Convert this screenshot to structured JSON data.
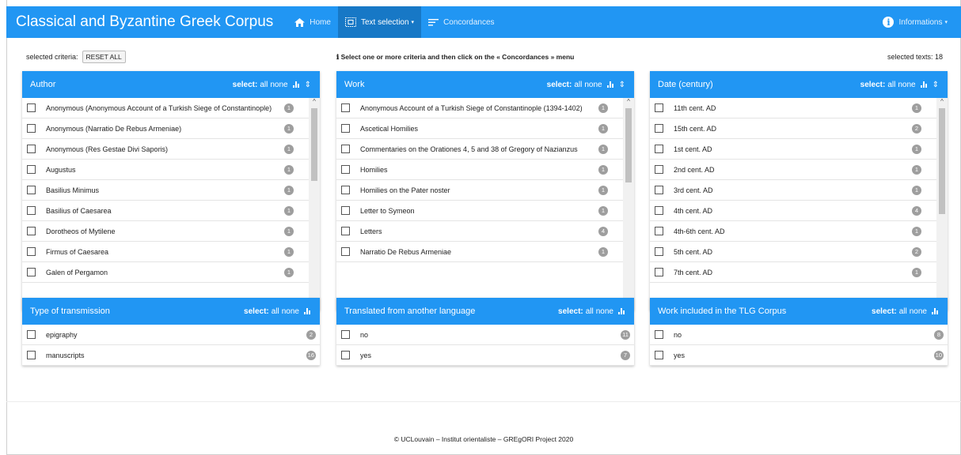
{
  "header": {
    "title": "Classical and Byzantine Greek Corpus",
    "nav": {
      "home": "Home",
      "text_selection": "Text selection",
      "concordances": "Concordances",
      "informations": "Informations"
    }
  },
  "criteria": {
    "label": "selected criteria:",
    "reset": "RESET ALL"
  },
  "hint": "ℹ Select one or more criteria and then click on the « Concordances » menu",
  "selected_texts": "selected texts:  18",
  "select": {
    "label": "select:",
    "all": "all",
    "none": "none"
  },
  "panels": {
    "author": {
      "title": "Author",
      "items": [
        {
          "label": "Anonymous (Anonymous Account of a Turkish Siege of Constantinople)",
          "count": "1"
        },
        {
          "label": "Anonymous (Narratio De Rebus Armeniae)",
          "count": "1"
        },
        {
          "label": "Anonymous (Res Gestae Divi Saporis)",
          "count": "1"
        },
        {
          "label": "Augustus",
          "count": "1"
        },
        {
          "label": "Basilius Minimus",
          "count": "1"
        },
        {
          "label": "Basilius of Caesarea",
          "count": "1"
        },
        {
          "label": "Dorotheos of Mytilene",
          "count": "1"
        },
        {
          "label": "Firmus of Caesarea",
          "count": "1"
        },
        {
          "label": "Galen of Pergamon",
          "count": "1"
        }
      ]
    },
    "work": {
      "title": "Work",
      "items": [
        {
          "label": "Anonymous Account of a Turkish Siege of Constantinople (1394-1402)",
          "count": "1"
        },
        {
          "label": "Ascetical Homilies",
          "count": "1"
        },
        {
          "label": "Commentaries on the Orationes 4, 5 and 38 of Gregory of Nazianzus",
          "count": "1"
        },
        {
          "label": "Homilies",
          "count": "1"
        },
        {
          "label": "Homilies on the Pater noster",
          "count": "1"
        },
        {
          "label": "Letter to Symeon",
          "count": "1"
        },
        {
          "label": "Letters",
          "count": "4"
        },
        {
          "label": "Narratio De Rebus Armeniae",
          "count": "1"
        }
      ]
    },
    "date": {
      "title": "Date (century)",
      "items": [
        {
          "label": "11th cent. AD",
          "count": "1"
        },
        {
          "label": "15th cent. AD",
          "count": "2"
        },
        {
          "label": "1st cent. AD",
          "count": "1"
        },
        {
          "label": "2nd cent. AD",
          "count": "1"
        },
        {
          "label": "3rd cent. AD",
          "count": "1"
        },
        {
          "label": "4th cent. AD",
          "count": "4"
        },
        {
          "label": "4th-6th cent. AD",
          "count": "1"
        },
        {
          "label": "5th cent. AD",
          "count": "2"
        },
        {
          "label": "7th cent. AD",
          "count": "1"
        }
      ]
    },
    "transmission": {
      "title": "Type of transmission",
      "items": [
        {
          "label": "epigraphy",
          "count": "2"
        },
        {
          "label": "manuscripts",
          "count": "16"
        }
      ]
    },
    "translated": {
      "title": "Translated from another language",
      "items": [
        {
          "label": "no",
          "count": "11"
        },
        {
          "label": "yes",
          "count": "7"
        }
      ]
    },
    "tlg": {
      "title": "Work included in the TLG Corpus",
      "items": [
        {
          "label": "no",
          "count": "8"
        },
        {
          "label": "yes",
          "count": "10"
        }
      ]
    }
  },
  "footer": "© UCLouvain – Institut orientaliste – GREgORI Project 2020"
}
